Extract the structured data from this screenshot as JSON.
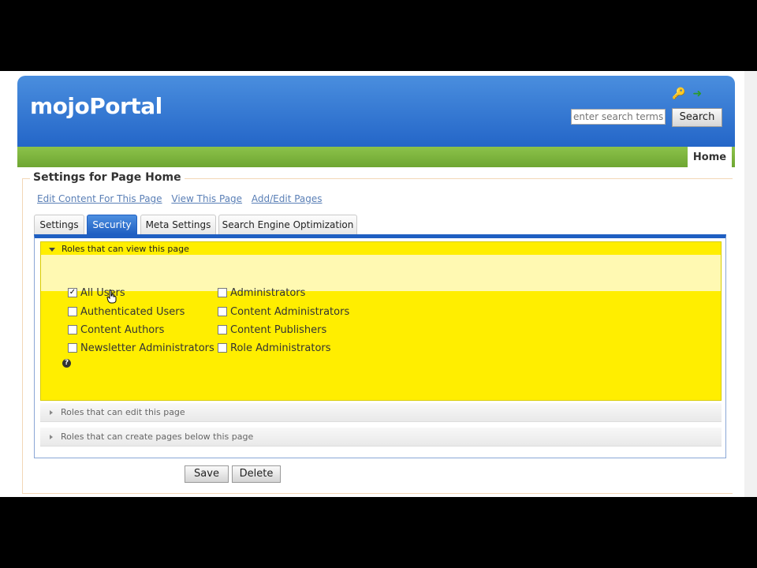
{
  "app": {
    "logo": "mojoPortal",
    "search_placeholder": "enter search terms",
    "search_button": "Search",
    "nav_home": "Home"
  },
  "page": {
    "title": "Settings for Page Home",
    "links": [
      "Edit Content For This Page",
      "View This Page",
      "Add/Edit Pages"
    ]
  },
  "tabs": [
    {
      "label": "Settings",
      "active": false
    },
    {
      "label": "Security",
      "active": true
    },
    {
      "label": "Meta Settings",
      "active": false
    },
    {
      "label": "Search Engine Optimization",
      "active": false
    }
  ],
  "accordion": {
    "view_header": "Roles that can view this page",
    "edit_header": "Roles that can edit this page",
    "create_header": "Roles that can create pages below this page"
  },
  "roles": [
    {
      "label": "All Users",
      "checked": true
    },
    {
      "label": "Administrators",
      "checked": false
    },
    {
      "label": "Authenticated Users",
      "checked": false
    },
    {
      "label": "Content Administrators",
      "checked": false
    },
    {
      "label": "Content Authors",
      "checked": false
    },
    {
      "label": "Content Publishers",
      "checked": false
    },
    {
      "label": "Newsletter Administrators",
      "checked": false
    },
    {
      "label": "Role Administrators",
      "checked": false
    }
  ],
  "buttons": {
    "save": "Save",
    "delete": "Delete"
  },
  "icons": {
    "help": "help-icon",
    "key": "key-icon",
    "exit": "exit-icon"
  },
  "colors": {
    "header_blue": "#2466c8",
    "nav_green": "#6ea632",
    "accordion_yellow": "#ffee00",
    "link_blue": "#5a7fb6"
  }
}
